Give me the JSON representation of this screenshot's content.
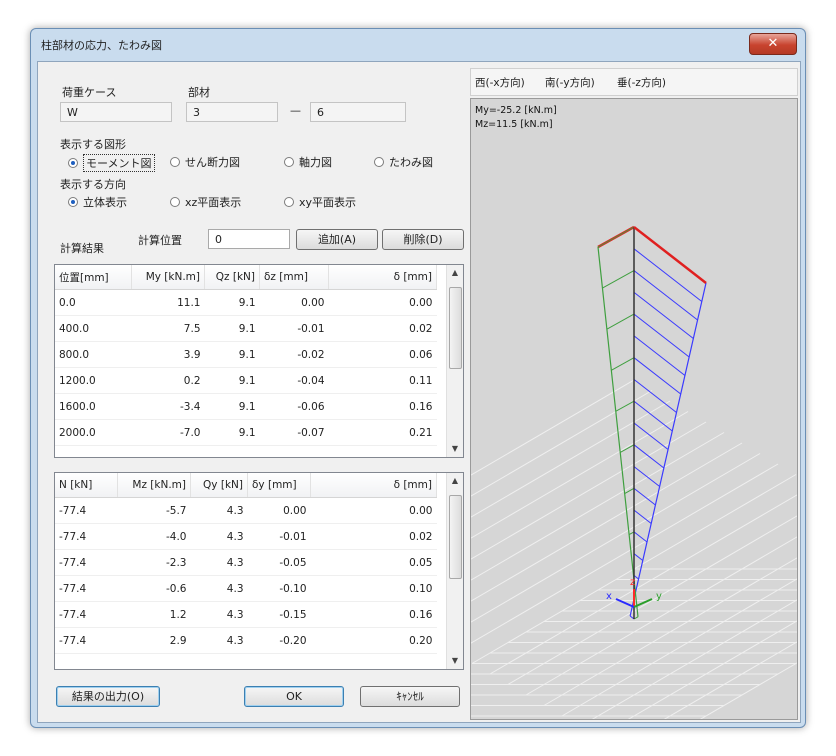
{
  "window": {
    "title": "柱部材の応力、たわみ図",
    "close_icon": "close-icon"
  },
  "left": {
    "load_case_label": "荷重ケース",
    "load_case_value": "W",
    "member_label": "部材",
    "member_from": "3",
    "member_sep": "—",
    "member_to": "6",
    "diagram_label": "表示する図形",
    "diagram_options": [
      "モーメント図",
      "せん断力図",
      "軸力図",
      "たわみ図"
    ],
    "diagram_selected": 0,
    "direction_label": "表示する方向",
    "direction_options": [
      "立体表示",
      "xz平面表示",
      "xy平面表示"
    ],
    "direction_selected": 0,
    "calc_label": "計算結果",
    "calc_pos_label": "計算位置",
    "calc_pos_value": "0",
    "add_button": "追加(A)",
    "delete_button": "削除(D)"
  },
  "table1": {
    "headers": [
      "位置[mm]",
      "My [kN.m]",
      "Qz [kN]",
      "δz [mm]",
      "δ [mm]"
    ],
    "rows": [
      [
        "0.0",
        "11.1",
        "9.1",
        "0.00",
        "0.00"
      ],
      [
        "400.0",
        "7.5",
        "9.1",
        "-0.01",
        "0.02"
      ],
      [
        "800.0",
        "3.9",
        "9.1",
        "-0.02",
        "0.06"
      ],
      [
        "1200.0",
        "0.2",
        "9.1",
        "-0.04",
        "0.11"
      ],
      [
        "1600.0",
        "-3.4",
        "9.1",
        "-0.06",
        "0.16"
      ],
      [
        "2000.0",
        "-7.0",
        "9.1",
        "-0.07",
        "0.21"
      ]
    ]
  },
  "table2": {
    "headers": [
      "N [kN]",
      "Mz [kN.m]",
      "Qy [kN]",
      "δy [mm]",
      "δ [mm]"
    ],
    "rows": [
      [
        "-77.4",
        "-5.7",
        "4.3",
        "0.00",
        "0.00"
      ],
      [
        "-77.4",
        "-4.0",
        "4.3",
        "-0.01",
        "0.02"
      ],
      [
        "-77.4",
        "-2.3",
        "4.3",
        "-0.05",
        "0.05"
      ],
      [
        "-77.4",
        "-0.6",
        "4.3",
        "-0.10",
        "0.10"
      ],
      [
        "-77.4",
        "1.2",
        "4.3",
        "-0.15",
        "0.16"
      ],
      [
        "-77.4",
        "2.9",
        "4.3",
        "-0.20",
        "0.20"
      ]
    ]
  },
  "bottom": {
    "output_button": "結果の出力(O)",
    "ok_button": "OK",
    "cancel_button": "ｷｬﾝｾﾙ"
  },
  "right": {
    "tabs": [
      "西(-x方向)",
      "南(-y方向)",
      "垂(-z方向)"
    ],
    "my_text": "My=-25.2 [kN.m]",
    "mz_text": "Mz=11.5 [kN.m]",
    "axis_x": "x",
    "axis_y": "y",
    "axis_z": "z",
    "colors": {
      "my_diagram": "#3a3aff",
      "mz_diagram": "#3f9f3f",
      "member_top": "#e02020",
      "grid": "#efefef",
      "member": "#333333"
    }
  }
}
